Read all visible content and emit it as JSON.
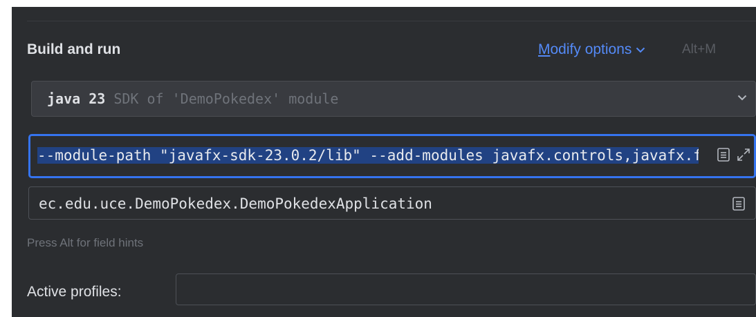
{
  "section": {
    "title": "Build and run",
    "modify_options": {
      "mnemonic": "M",
      "rest": "odify options",
      "shortcut": "Alt+M"
    }
  },
  "sdk": {
    "main": "java 23",
    "hint": "SDK of 'DemoPokedex' module"
  },
  "vm_options": {
    "value": "--module-path \"javafx-sdk-23.0.2/lib\" --add-modules javafx.controls,javafx.fxml"
  },
  "main_class": {
    "value": "ec.edu.uce.DemoPokedex.DemoPokedexApplication"
  },
  "field_hint": "Press Alt for field hints",
  "active_profiles": {
    "label": "Active profiles:",
    "value": ""
  },
  "colors": {
    "accent": "#3574f0",
    "link": "#548af7",
    "selection": "#214283",
    "panel_bg": "#2b2d30"
  },
  "icons": {
    "modify_options": "chevron-down-icon",
    "sdk_select": "chevron-down-icon",
    "vm_options": [
      "list-icon",
      "expand-icon"
    ],
    "main_class": "list-icon"
  }
}
